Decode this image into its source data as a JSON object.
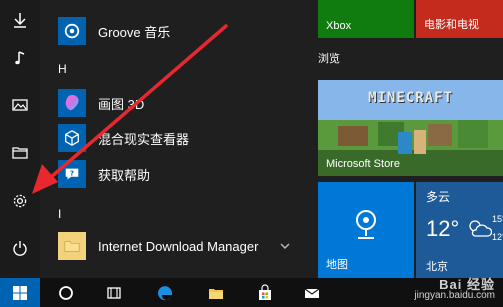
{
  "apps": [
    {
      "label": "Groove 音乐"
    },
    {
      "label": "画图 3D"
    },
    {
      "label": "混合现实查看器"
    },
    {
      "label": "获取帮助"
    },
    {
      "label": "Internet Download Manager"
    }
  ],
  "letters": {
    "h": "H",
    "i": "I"
  },
  "tiles": {
    "xbox": "Xbox",
    "movies": "电影和电视",
    "group_browse": "浏览",
    "minecraft_logo": "MINECRAFT",
    "store": "Microsoft Store",
    "weather_condition": "多云",
    "weather_temp": "12°",
    "weather_hi": "15°",
    "weather_lo": "12°",
    "weather_city": "北京",
    "maps": "地图"
  },
  "watermark": {
    "brand": "Bai 经验",
    "url": "jingyan.baidu.com"
  },
  "colors": {
    "accent": "#0063b1",
    "arrow": "#e8282e",
    "xbox": "#107c10",
    "movies": "#c42b1c"
  }
}
